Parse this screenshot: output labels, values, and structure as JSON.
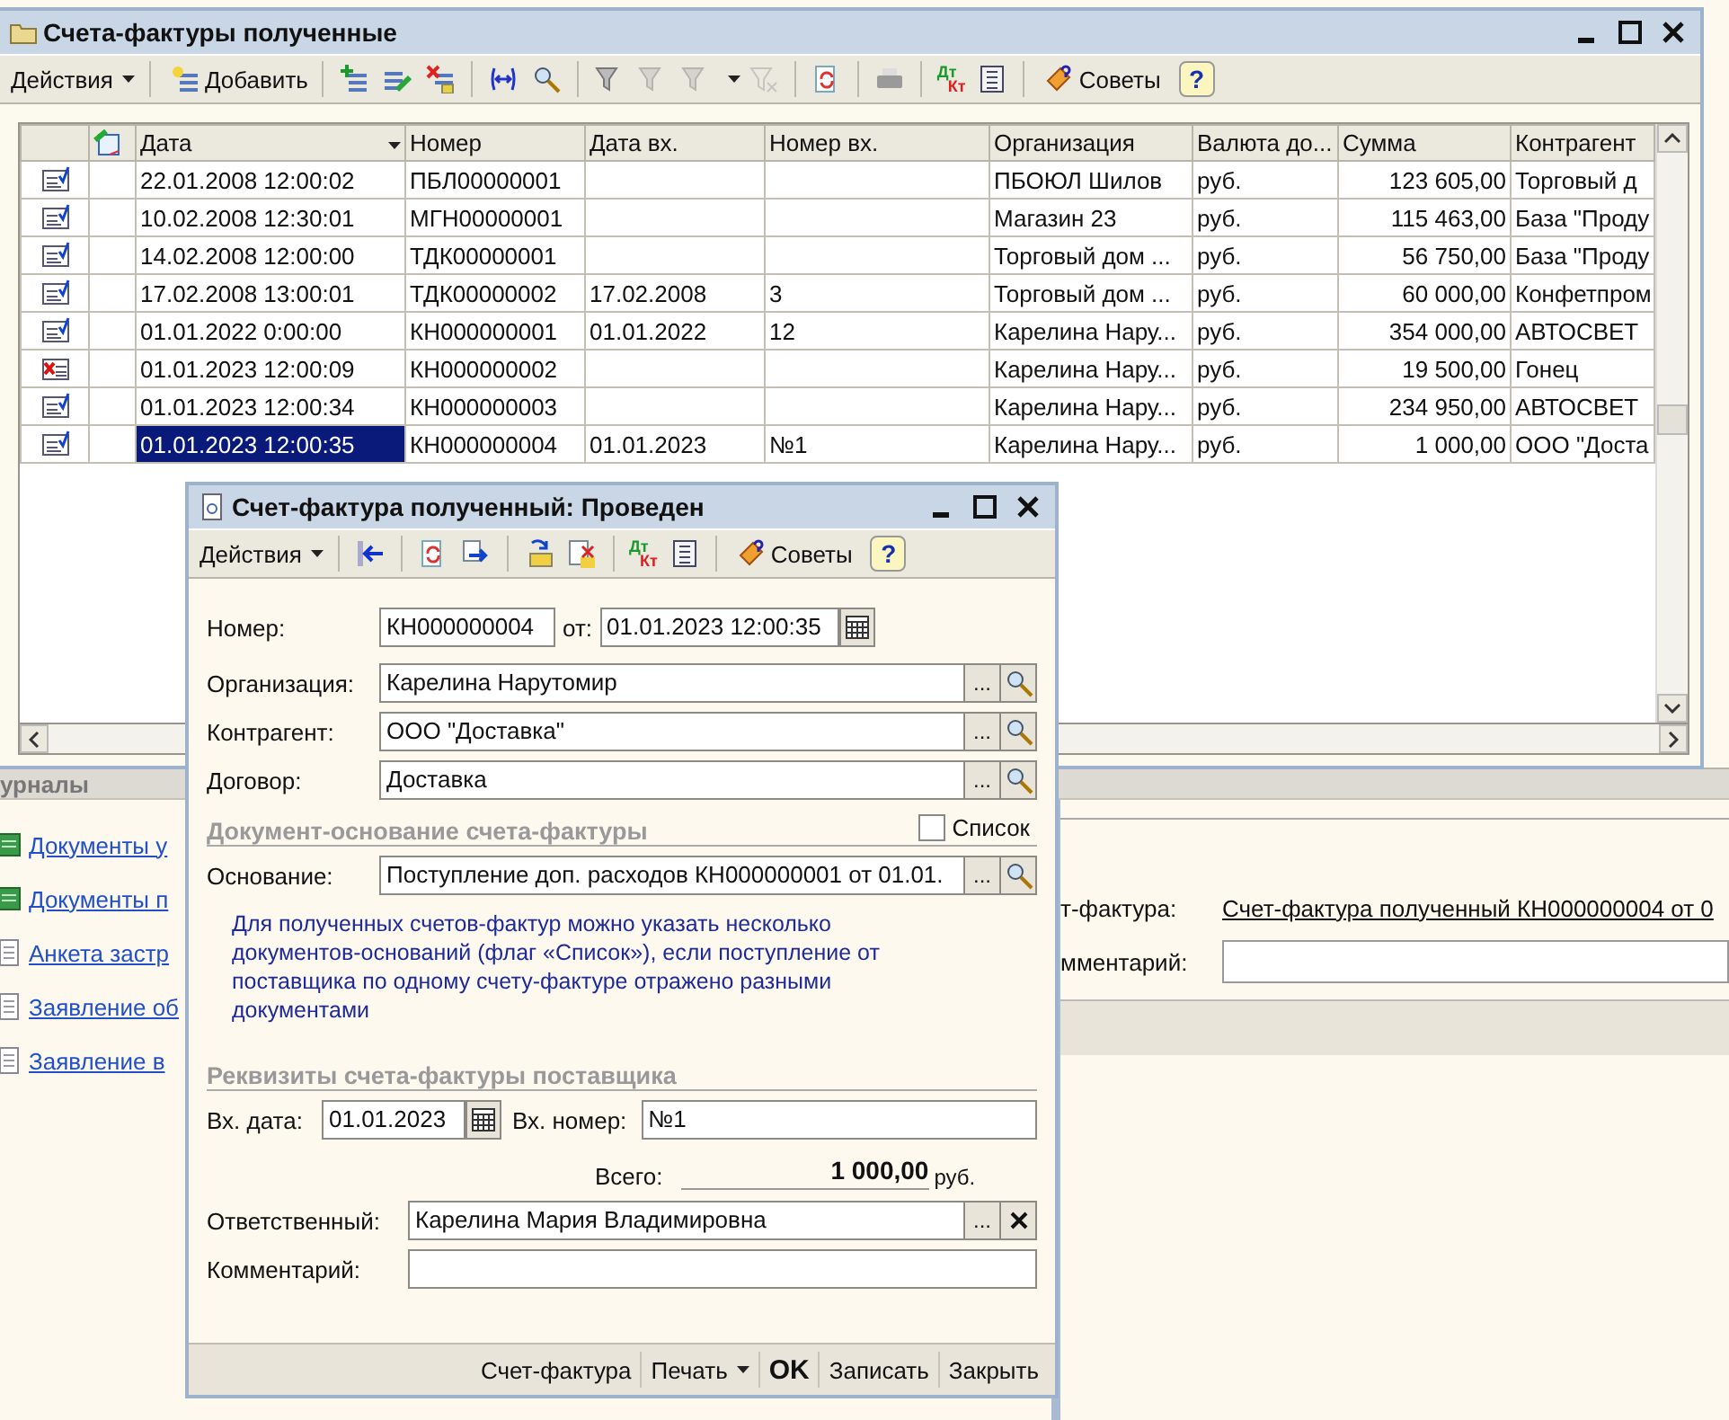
{
  "list_window": {
    "title": "Счета-фактуры полученные",
    "toolbar": {
      "actions": "Действия",
      "add": "Добавить",
      "debit": "Дт",
      "credit": "Кт",
      "tips": "Советы",
      "help": "?"
    },
    "columns": [
      {
        "title": "Дата",
        "sorted": true
      },
      {
        "title": "Номер",
        "sorted": false
      },
      {
        "title": "Дата вх.",
        "sorted": false
      },
      {
        "title": "Номер вх.",
        "sorted": false
      },
      {
        "title": "Организация",
        "sorted": false
      },
      {
        "title": "Валюта до...",
        "sorted": false
      },
      {
        "title": "Сумма",
        "sorted": false
      },
      {
        "title": "Контрагент",
        "sorted": false
      }
    ],
    "rows": [
      {
        "kind": "posted",
        "selected": false,
        "date": "22.01.2008 12:00:02",
        "number": "ПБЛ00000001",
        "organization": "ПБОЮЛ  Шилов",
        "currency": "руб.",
        "sum": "123 605,00",
        "counterparty": "Торговый д"
      },
      {
        "kind": "posted",
        "selected": false,
        "date": "10.02.2008 12:30:01",
        "number": "МГН00000001",
        "organization": "Магазин 23",
        "currency": "руб.",
        "sum": "115 463,00",
        "counterparty": "База \"Проду"
      },
      {
        "kind": "posted",
        "selected": false,
        "date": "14.02.2008 12:00:00",
        "number": "ТДК00000001",
        "organization": "Торговый дом ...",
        "currency": "руб.",
        "sum": "56 750,00",
        "counterparty": "База \"Проду"
      },
      {
        "kind": "posted",
        "selected": false,
        "date": "17.02.2008 13:00:01",
        "number": "ТДК00000002",
        "in_date": "17.02.2008",
        "in_number": "3",
        "organization": "Торговый дом ...",
        "currency": "руб.",
        "sum": "60 000,00",
        "counterparty": "Конфетпром"
      },
      {
        "kind": "posted",
        "selected": false,
        "date": "01.01.2022 0:00:00",
        "number": "КН000000001",
        "in_date": "01.01.2022",
        "in_number": "12",
        "organization": "Карелина Нару...",
        "currency": "руб.",
        "sum": "354 000,00",
        "counterparty": "АВТОСВЕТ"
      },
      {
        "kind": "deleted",
        "selected": false,
        "date": "01.01.2023 12:00:09",
        "number": "КН000000002",
        "organization": "Карелина Нару...",
        "currency": "руб.",
        "sum": "19 500,00",
        "counterparty": "Гонец"
      },
      {
        "kind": "posted",
        "selected": false,
        "date": "01.01.2023 12:00:34",
        "number": "КН000000003",
        "organization": "Карелина Нару...",
        "currency": "руб.",
        "sum": "234 950,00",
        "counterparty": "АВТОСВЕТ"
      },
      {
        "kind": "posted",
        "selected": true,
        "date": "01.01.2023 12:00:35",
        "number": "КН000000004",
        "in_date": "01.01.2023",
        "in_number": "№1",
        "organization": "Карелина Нару...",
        "currency": "руб.",
        "sum": "1 000,00",
        "counterparty": "ООО \"Доста"
      }
    ]
  },
  "background_form": {
    "heading": "урналы",
    "links": [
      {
        "kind": "journal",
        "text": "Документы у"
      },
      {
        "kind": "journal",
        "text": "Документы п"
      },
      {
        "kind": "form",
        "text": "Анкета застр"
      },
      {
        "kind": "form",
        "text": "Заявление об"
      },
      {
        "kind": "form",
        "text": "Заявление в"
      }
    ],
    "invoice_label": "т-фактура:",
    "invoice_link": "Счет-фактура полученный КН000000004 от 0",
    "comment_label": "мментарий:"
  },
  "dialog": {
    "title": "Счет-фактура полученный: Проведен",
    "toolbar": {
      "actions": "Действия",
      "debit": "Дт",
      "credit": "Кт",
      "tips": "Советы",
      "help": "?"
    },
    "number_label": "Номер:",
    "number": "КН000000004",
    "from_label": "от:",
    "date": "01.01.2023 12:00:35",
    "ref_fields": [
      {
        "label": "Организация:",
        "value": "Карелина Нарутомир",
        "choose": "..."
      },
      {
        "label": "Контрагент:",
        "value": "ООО \"Доставка\"",
        "choose": "..."
      },
      {
        "label": "Договор:",
        "value": "Доставка",
        "choose": "..."
      }
    ],
    "basis_section": "Документ-основание счета-фактуры",
    "list_checkbox": {
      "label": "Список",
      "checked": false
    },
    "basis_label": "Основание:",
    "basis": "Поступление доп. расходов КН000000001 от 01.01.",
    "basis_choose": "...",
    "note": "Для полученных счетов-фактур можно указать несколько документов-оснований (флаг «Список»), если поступление от поставщика по одному счету-фактуре отражено разными документами",
    "supplier_section": "Реквизиты счета-фактуры поставщика",
    "in_date_label": "Вх. дата:",
    "in_date": "01.01.2023",
    "in_number_label": "Вх. номер:",
    "in_number": "№1",
    "total_label": "Всего:",
    "total": "1 000,00",
    "currency": "руб.",
    "responsible_label": "Ответственный:",
    "responsible": "Карелина Мария Владимировна",
    "responsible_choose": "...",
    "comment_label": "Комментарий:",
    "buttons": [
      {
        "kind": "plain",
        "label": "Счет-фактура"
      },
      {
        "kind": "menu",
        "label": "Печать"
      },
      {
        "kind": "default",
        "label": "OK"
      },
      {
        "kind": "plain",
        "label": "Записать"
      },
      {
        "kind": "plain",
        "label": "Закрыть"
      }
    ]
  }
}
